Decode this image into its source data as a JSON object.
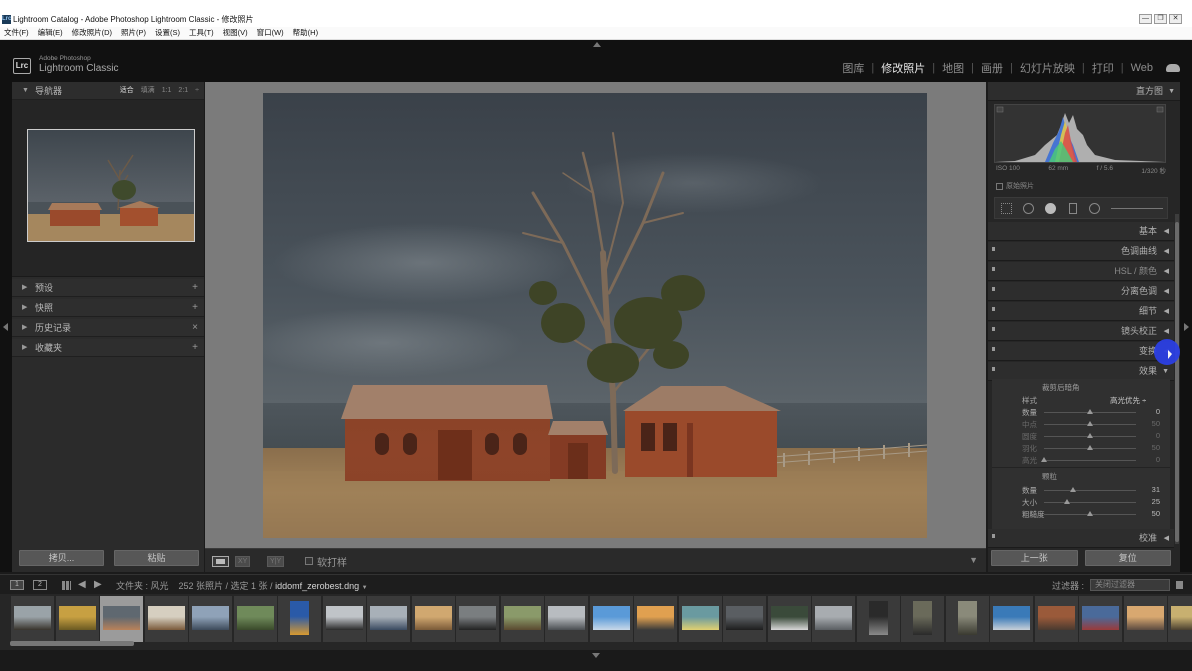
{
  "window": {
    "app_icon": "Lrc",
    "title": "Lightroom Catalog - Adobe Photoshop Lightroom Classic - 修改照片",
    "controls": [
      "—",
      "❐",
      "✕"
    ]
  },
  "menu": [
    "文件(F)",
    "编辑(E)",
    "修改照片(D)",
    "照片(P)",
    "设置(S)",
    "工具(T)",
    "视图(V)",
    "窗口(W)",
    "帮助(H)"
  ],
  "identity": {
    "logo": "Lrc",
    "brand_line1": "Adobe Photoshop",
    "brand_line2": "Lightroom Classic"
  },
  "modules": [
    {
      "label": "图库",
      "active": false
    },
    {
      "label": "修改照片",
      "active": true
    },
    {
      "label": "地图",
      "active": false
    },
    {
      "label": "画册",
      "active": false
    },
    {
      "label": "幻灯片放映",
      "active": false
    },
    {
      "label": "打印",
      "active": false
    },
    {
      "label": "Web",
      "active": false
    }
  ],
  "left_panel": {
    "navigator": {
      "title": "导航器",
      "zoom_options": [
        "适合",
        "填满",
        "1:1",
        "2:1"
      ],
      "zoom_active": 0
    },
    "sections": [
      {
        "label": "预设",
        "action": "+"
      },
      {
        "label": "快照",
        "action": "+"
      },
      {
        "label": "历史记录",
        "action": "×"
      },
      {
        "label": "收藏夹",
        "action": "+"
      }
    ],
    "copy_label": "拷贝...",
    "paste_label": "粘贴"
  },
  "toolbar": {
    "view_groups": [
      "XY",
      "Y|Y"
    ],
    "soft_proof_label": "软打样",
    "menu_arrow": "▼"
  },
  "right_panel": {
    "histogram_title": "直方图",
    "hist_meta": [
      "ISO 100",
      "62 mm",
      "f / 5.6",
      "1/320 秒"
    ],
    "original_photo_label": "原始照片",
    "panels": [
      {
        "label": "基本",
        "tri": "◀"
      },
      {
        "label": "色调曲线",
        "tri": "◀"
      },
      {
        "label": "HSL / 颜色",
        "tri": "◀"
      },
      {
        "label": "分离色调",
        "tri": "◀"
      },
      {
        "label": "细节",
        "tri": "◀"
      },
      {
        "label": "镜头校正",
        "tri": "◀"
      },
      {
        "label": "变换",
        "tri": "◀"
      },
      {
        "label": "效果",
        "tri": "▼"
      }
    ],
    "effects": {
      "vignette_title": "裁剪后暗角",
      "style_label": "样式",
      "style_value": "高光优先 ÷",
      "vignette_rows": [
        {
          "name": "数量",
          "value": "0",
          "pos": 0.5,
          "dim": false
        },
        {
          "name": "中点",
          "value": "50",
          "pos": 0.5,
          "dim": true
        },
        {
          "name": "圆度",
          "value": "0",
          "pos": 0.5,
          "dim": true
        },
        {
          "name": "羽化",
          "value": "50",
          "pos": 0.5,
          "dim": true
        },
        {
          "name": "高光",
          "value": "0",
          "pos": 0.0,
          "dim": true
        }
      ],
      "grain_title": "颗粒",
      "grain_rows": [
        {
          "name": "数量",
          "value": "31",
          "pos": 0.31,
          "dim": false
        },
        {
          "name": "大小",
          "value": "25",
          "pos": 0.25,
          "dim": false
        },
        {
          "name": "粗糙度",
          "value": "50",
          "pos": 0.5,
          "dim": false
        }
      ]
    },
    "calibration_label": "校准",
    "prev_label": "上一张",
    "reset_label": "复位"
  },
  "filmstrip": {
    "pages": [
      "1",
      "2"
    ],
    "source_label": "文件夹 : 风光",
    "count_text": "252 张照片 / 选定 1 张 /",
    "filename": "iddomf_zerobest.dng",
    "dropdown": "▼",
    "filter_label": "过滤器 :",
    "filter_value": "关闭过滤器",
    "thumbs": [
      {
        "c1": "#9aa3a8",
        "c2": "#38342c",
        "tall": false
      },
      {
        "c1": "#c7a042",
        "c2": "#6a5a22",
        "tall": false
      },
      {
        "c1": "#5f6870",
        "c2": "#b9825a",
        "tall": false
      },
      {
        "c1": "#d6cfc0",
        "c2": "#7a5a3a",
        "tall": false
      },
      {
        "c1": "#8fa2b8",
        "c2": "#3d4a5a",
        "tall": false
      },
      {
        "c1": "#6f8a5a",
        "c2": "#3a4a2a",
        "tall": false
      },
      {
        "c1": "#2a5aa8",
        "c2": "#d89a30",
        "tall": true
      },
      {
        "c1": "#c0c4c8",
        "c2": "#2a2a2a",
        "tall": false
      },
      {
        "c1": "#a8b0b8",
        "c2": "#3a4a60",
        "tall": false
      },
      {
        "c1": "#d0a870",
        "c2": "#7a5a38",
        "tall": false
      },
      {
        "c1": "#7a7e80",
        "c2": "#222",
        "tall": false
      },
      {
        "c1": "#8a9a6a",
        "c2": "#5a4a30",
        "tall": false
      },
      {
        "c1": "#b8bcc0",
        "c2": "#4a4e52",
        "tall": false
      },
      {
        "c1": "#5a9ad8",
        "c2": "#c8d8e8",
        "tall": false
      },
      {
        "c1": "#e0a050",
        "c2": "#3a3a3a",
        "tall": false
      },
      {
        "c1": "#6a9aa0",
        "c2": "#e0d070",
        "tall": false
      },
      {
        "c1": "#5a5e62",
        "c2": "#1e1e1e",
        "tall": false
      },
      {
        "c1": "#3a4a3a",
        "c2": "#d8d8d8",
        "tall": false
      },
      {
        "c1": "#a8acb0",
        "c2": "#5a5e62",
        "tall": false
      },
      {
        "c1": "#2a2a2a",
        "c2": "#8a8a8a",
        "tall": true
      },
      {
        "c1": "#6a6a5a",
        "c2": "#2a2a2a",
        "tall": true
      },
      {
        "c1": "#8a8a7a",
        "c2": "#3a3a30",
        "tall": true
      },
      {
        "c1": "#3a7ab8",
        "c2": "#c8d0d8",
        "tall": false
      },
      {
        "c1": "#9a5a3a",
        "c2": "#4a3a30",
        "tall": false
      },
      {
        "c1": "#4a6a9a",
        "c2": "#9a3a3a",
        "tall": false
      },
      {
        "c1": "#d8a870",
        "c2": "#5a4a40",
        "tall": false
      },
      {
        "c1": "#c8b070",
        "c2": "#4a4030",
        "tall": false
      }
    ],
    "selected_index": 2
  },
  "colors": {
    "accent_cursor": "#2b3fe3",
    "panel_bg": "#2b2b2b",
    "canvas_bg": "#7b7b7b"
  }
}
